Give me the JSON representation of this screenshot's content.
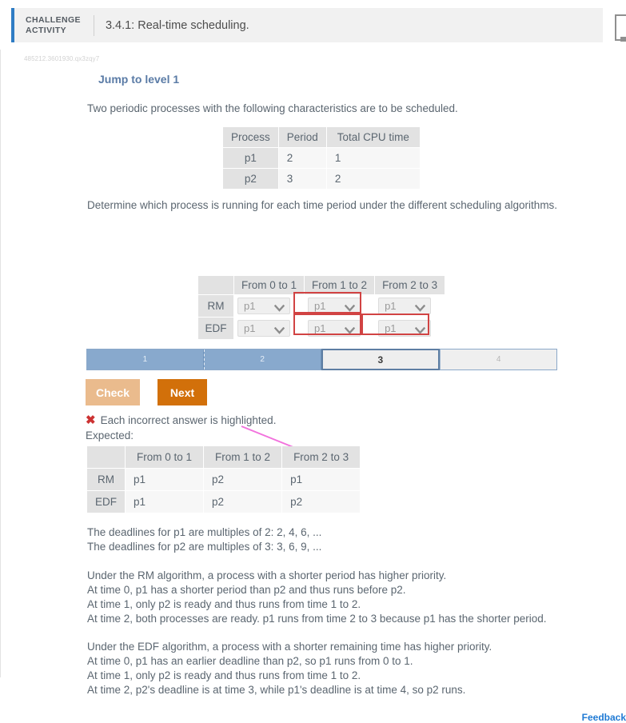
{
  "header": {
    "badge": "CHALLENGE\nACTIVITY",
    "title": "3.4.1: Real-time scheduling."
  },
  "activity_id": "485212.3601930.qx3zqy7",
  "jump_link": "Jump to level 1",
  "intro_text": "Two periodic processes with the following characteristics are to be scheduled.",
  "characteristics_table": {
    "headers": [
      "Process",
      "Period",
      "Total CPU time"
    ],
    "rows": [
      {
        "process": "p1",
        "period": "2",
        "cpu": "1"
      },
      {
        "process": "p2",
        "period": "3",
        "cpu": "2"
      }
    ]
  },
  "determine_text": "Determine which process is running for each time period under the different scheduling algorithms.",
  "answer_table": {
    "corner": "",
    "headers": [
      "From 0 to 1",
      "From 1 to 2",
      "From 2 to 3"
    ],
    "rows": [
      {
        "label": "RM",
        "values": [
          "p1",
          "p1",
          "p1"
        ]
      },
      {
        "label": "EDF",
        "values": [
          "p1",
          "p1",
          "p1"
        ]
      }
    ],
    "dropdown_icon": "chevron-down-icon",
    "highlight_color": "#d14343"
  },
  "levels": [
    {
      "label": "1",
      "state": "done"
    },
    {
      "label": "2",
      "state": "done"
    },
    {
      "label": "3",
      "state": "current"
    },
    {
      "label": "4",
      "state": "todo"
    }
  ],
  "buttons": {
    "check": "Check",
    "next": "Next"
  },
  "feedback": {
    "mark": "✖",
    "message": "Each incorrect answer is highlighted.",
    "expected_label": "Expected:"
  },
  "expected_table": {
    "corner": "",
    "headers": [
      "From 0 to 1",
      "From 1 to 2",
      "From 2 to 3"
    ],
    "rows": [
      {
        "label": "RM",
        "values": [
          "p1",
          "p2",
          "p1"
        ]
      },
      {
        "label": "EDF",
        "values": [
          "p1",
          "p2",
          "p2"
        ]
      }
    ]
  },
  "explanation": {
    "deadlines": "The deadlines for p1 are multiples of 2: 2, 4, 6, ...\nThe deadlines for p2 are multiples of 3: 3, 6, 9, ...",
    "rm": "Under the RM algorithm, a process with a shorter period has higher priority.\nAt time 0, p1 has a shorter period than p2 and thus runs before p2.\nAt time 1, only p2 is ready and thus runs from time 1 to 2.\nAt time 2, both processes are ready. p1 runs from time 2 to 3 because p1 has the shorter period.",
    "edf": "Under the EDF algorithm, a process with a shorter remaining time has higher priority.\nAt time 0, p1 has an earlier deadline than p2, so p1 runs from 0 to 1.\nAt time 1, only p2 is ready and thus runs from time 1 to 2.\nAt time 2, p2's deadline is at time 3, while p1's deadline is at time 4, so p2 runs."
  },
  "feedback_link": "Feedback"
}
